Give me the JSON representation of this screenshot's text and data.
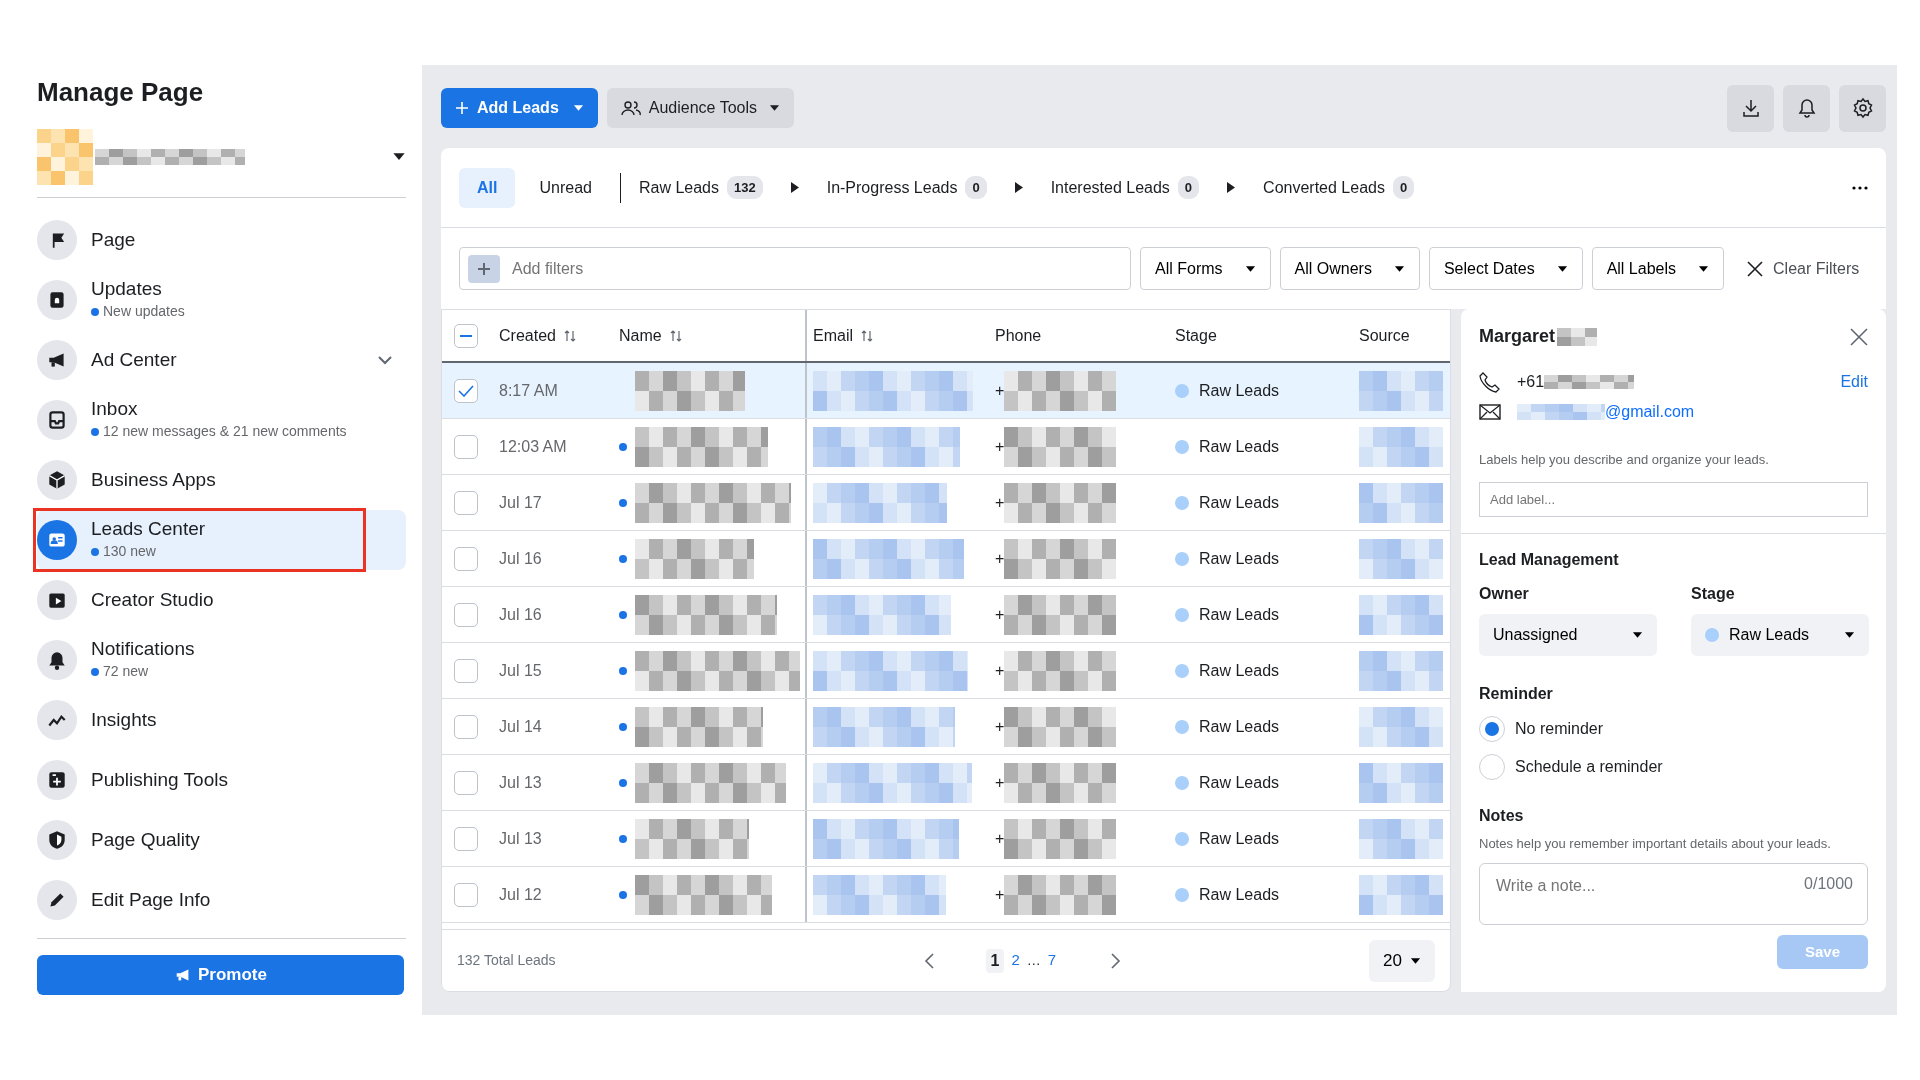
{
  "sidebar": {
    "title": "Manage Page",
    "items": [
      {
        "label": "Page",
        "kind": "link",
        "selected": false,
        "highlighted": false
      },
      {
        "label": "Updates",
        "subtitle": "New updates",
        "kind": "link",
        "selected": false,
        "highlighted": false
      },
      {
        "label": "Ad Center",
        "kind": "group",
        "selected": false,
        "highlighted": false
      },
      {
        "label": "Inbox",
        "subtitle": "12 new messages & 21 new comments",
        "kind": "link",
        "selected": false,
        "highlighted": false
      },
      {
        "label": "Business Apps",
        "kind": "link",
        "selected": false,
        "highlighted": false
      },
      {
        "label": "Leads Center",
        "subtitle": "130 new",
        "kind": "link",
        "selected": true,
        "highlighted": true
      },
      {
        "label": "Creator Studio",
        "kind": "link",
        "selected": false,
        "highlighted": false
      },
      {
        "label": "Notifications",
        "subtitle": "72 new",
        "kind": "link",
        "selected": false,
        "highlighted": false
      },
      {
        "label": "Insights",
        "kind": "link",
        "selected": false,
        "highlighted": false
      },
      {
        "label": "Publishing Tools",
        "kind": "link",
        "selected": false,
        "highlighted": false
      },
      {
        "label": "Page Quality",
        "kind": "link",
        "selected": false,
        "highlighted": false
      },
      {
        "label": "Edit Page Info",
        "kind": "link",
        "selected": false,
        "highlighted": false
      }
    ],
    "promote_button": "Promote"
  },
  "toolbar": {
    "add_leads": "Add Leads",
    "audience_tools": "Audience Tools"
  },
  "tabs": [
    {
      "label": "All",
      "kind": "filter",
      "selected": true
    },
    {
      "label": "Unread",
      "kind": "filter",
      "selected": false
    },
    {
      "label": "Raw Leads",
      "count": "132",
      "kind": "stage",
      "selected": false
    },
    {
      "label": "In-Progress Leads",
      "count": "0",
      "kind": "stage",
      "selected": false
    },
    {
      "label": "Interested Leads",
      "count": "0",
      "kind": "stage",
      "selected": false
    },
    {
      "label": "Converted Leads",
      "count": "0",
      "kind": "stage",
      "selected": false
    }
  ],
  "filters": {
    "placeholder": "Add filters",
    "dropdowns": [
      "All Forms",
      "All Owners",
      "Select Dates",
      "All Labels"
    ],
    "clear": "Clear Filters"
  },
  "table": {
    "header_checkbox_indeterminate": true,
    "columns": [
      {
        "label": "Created",
        "sortable": true
      },
      {
        "label": "Name",
        "sortable": true
      },
      {
        "label": "Email",
        "sortable": true
      },
      {
        "label": "Phone",
        "sortable": false
      },
      {
        "label": "Stage",
        "sortable": false
      },
      {
        "label": "Source",
        "sortable": false
      }
    ],
    "rows": [
      {
        "created": "8:17 AM",
        "unread": false,
        "selected": true,
        "phone": "+",
        "stage": "Raw Leads"
      },
      {
        "created": "12:03 AM",
        "unread": true,
        "selected": false,
        "phone": "+",
        "stage": "Raw Leads"
      },
      {
        "created": "Jul 17",
        "unread": true,
        "selected": false,
        "phone": "+",
        "stage": "Raw Leads"
      },
      {
        "created": "Jul 16",
        "unread": true,
        "selected": false,
        "phone": "+",
        "stage": "Raw Leads"
      },
      {
        "created": "Jul 16",
        "unread": true,
        "selected": false,
        "phone": "+",
        "stage": "Raw Leads"
      },
      {
        "created": "Jul 15",
        "unread": true,
        "selected": false,
        "phone": "+",
        "stage": "Raw Leads"
      },
      {
        "created": "Jul 14",
        "unread": true,
        "selected": false,
        "phone": "+",
        "stage": "Raw Leads"
      },
      {
        "created": "Jul 13",
        "unread": true,
        "selected": false,
        "phone": "+",
        "stage": "Raw Leads"
      },
      {
        "created": "Jul 13",
        "unread": true,
        "selected": false,
        "phone": "+",
        "stage": "Raw Leads"
      },
      {
        "created": "Jul 12",
        "unread": true,
        "selected": false,
        "phone": "+",
        "stage": "Raw Leads"
      }
    ],
    "footer": {
      "total": "132 Total Leads",
      "pages": [
        {
          "label": "1",
          "kind": "page",
          "selected": true
        },
        {
          "label": "2",
          "kind": "page",
          "selected": false
        },
        {
          "label": "…",
          "kind": "ellipsis",
          "selected": false
        },
        {
          "label": "7",
          "kind": "page",
          "selected": false
        }
      ],
      "page_size": "20"
    }
  },
  "panel": {
    "name": "Margaret",
    "phone": "+61",
    "edit": "Edit",
    "email": "@gmail.com",
    "labels_hint": "Labels help you describe and organize your leads.",
    "label_placeholder": "Add label...",
    "section_title": "Lead Management",
    "owner_label": "Owner",
    "owner_value": "Unassigned",
    "stage_label": "Stage",
    "stage_value": "Raw Leads",
    "reminder": {
      "title": "Reminder",
      "options": [
        {
          "label": "No reminder",
          "selected": true
        },
        {
          "label": "Schedule a reminder",
          "selected": false
        }
      ]
    },
    "notes_title": "Notes",
    "notes_hint": "Notes help you remember important details about your leads.",
    "note_placeholder": "Write a note...",
    "note_counter": "0/1000",
    "save": "Save",
    "save_disabled": true
  }
}
